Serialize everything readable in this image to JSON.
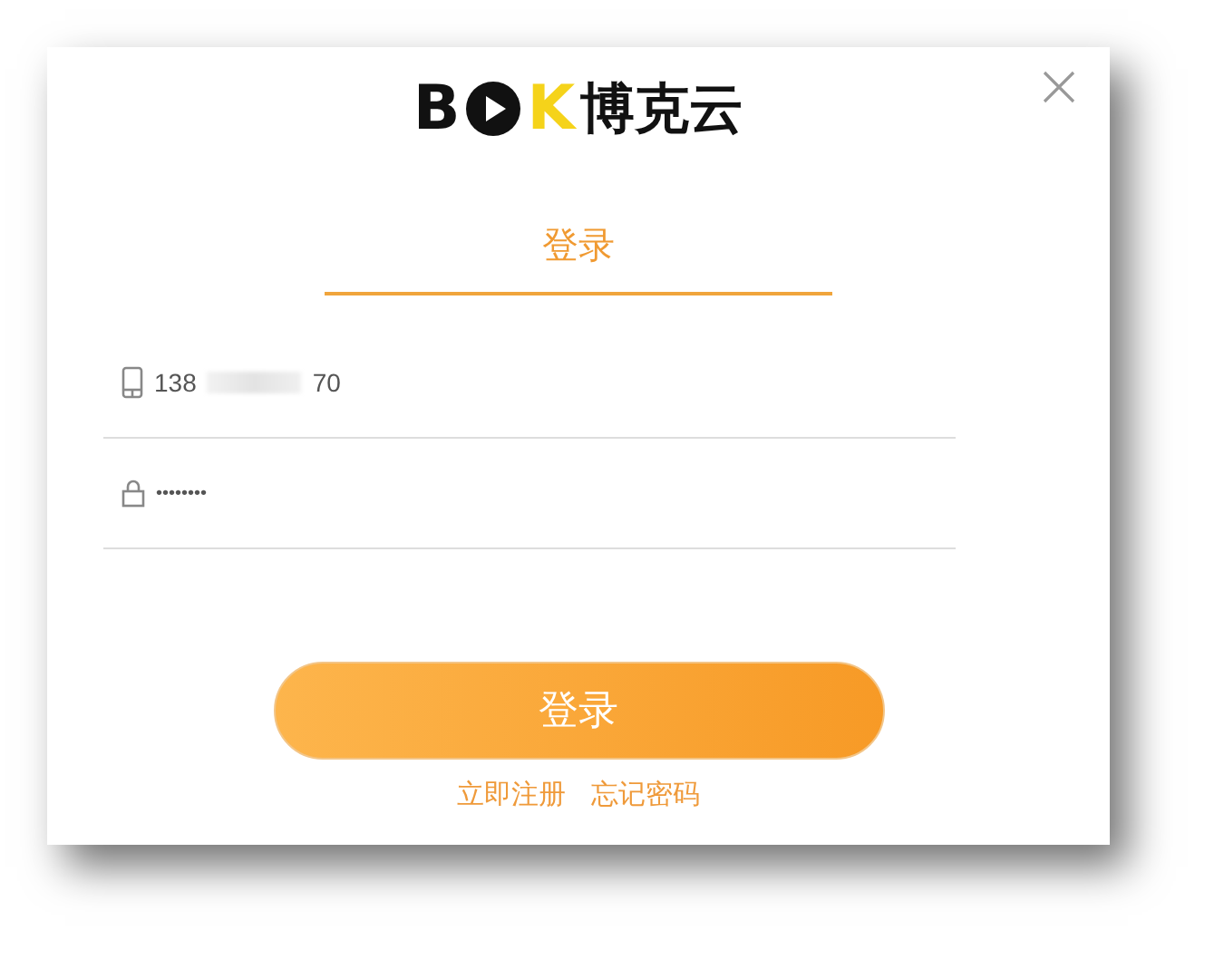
{
  "logo": {
    "letter_1": "B",
    "letter_2": "K",
    "name": "博克云"
  },
  "tabs": [
    {
      "label": "登录",
      "selected": true
    }
  ],
  "fields": [
    {
      "kind": "phone",
      "value_start": "138",
      "value_end": "70",
      "blurred": true
    },
    {
      "kind": "password",
      "value": "••••••••"
    }
  ],
  "submit": "登录",
  "links": [
    "立即注册",
    "忘记密码"
  ]
}
